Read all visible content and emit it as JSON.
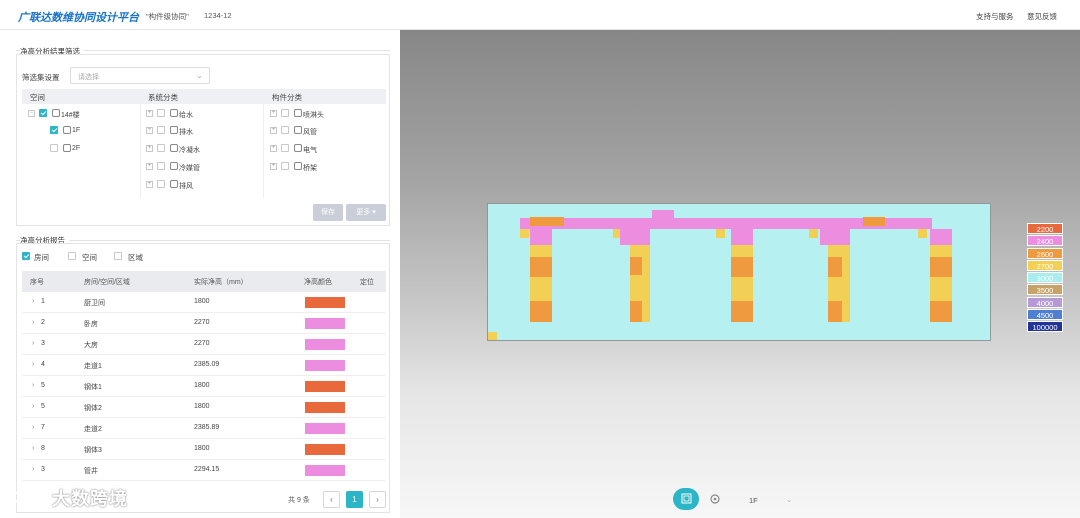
{
  "header": {
    "brand": "广联达数维协同设计平台",
    "project": "\"构件级协同\"",
    "project_code": "1234-12",
    "links": [
      "支持与服务",
      "意见反馈"
    ]
  },
  "filter": {
    "title": "净高分析结果筛选",
    "set_label": "筛选集设置",
    "set_placeholder": "请选择",
    "columns": [
      "空间",
      "系统分类",
      "构件分类"
    ],
    "space_tree": [
      {
        "label": "14#楼",
        "checked": true
      },
      {
        "label": "1F",
        "checked": true
      },
      {
        "label": "2F",
        "checked": false
      }
    ],
    "system_items": [
      "给水",
      "排水",
      "冷凝水",
      "冷媒管",
      "排风"
    ],
    "component_items": [
      "喷淋头",
      "风管",
      "电气",
      "桥架"
    ],
    "save_label": "保存",
    "more_label": "更多 ▾"
  },
  "report": {
    "title": "净高分析报告",
    "filters": [
      {
        "label": "房间",
        "checked": true
      },
      {
        "label": "空间",
        "checked": false
      },
      {
        "label": "区域",
        "checked": false
      }
    ],
    "columns": [
      "序号",
      "房间/空间/区域",
      "实际净高（mm）",
      "净高颜色",
      "定位"
    ],
    "rows": [
      {
        "no": "1",
        "name": "厨卫间",
        "height": "1800",
        "color": "#e8693b"
      },
      {
        "no": "2",
        "name": "卧房",
        "height": "2270",
        "color": "#ec8de0"
      },
      {
        "no": "3",
        "name": "大房",
        "height": "2270",
        "color": "#ec8de0"
      },
      {
        "no": "4",
        "name": "走道1",
        "height": "2385.09",
        "color": "#ec8de0"
      },
      {
        "no": "5",
        "name": "钢体1",
        "height": "1800",
        "color": "#e8693b"
      },
      {
        "no": "5",
        "name": "钢体2",
        "height": "1800",
        "color": "#e8693b"
      },
      {
        "no": "7",
        "name": "走道2",
        "height": "2385.89",
        "color": "#ec8de0"
      },
      {
        "no": "8",
        "name": "钢体3",
        "height": "1800",
        "color": "#e8693b"
      },
      {
        "no": "3",
        "name": "管井",
        "height": "2294.15",
        "color": "#ec8de0"
      }
    ],
    "total": "共 9 条",
    "current_page": "1",
    "prev": "‹",
    "next": "›"
  },
  "legend": [
    {
      "label": "2200",
      "color": "#e8693b"
    },
    {
      "label": "2400",
      "color": "#ec8de0"
    },
    {
      "label": "2600",
      "color": "#ef9a3f"
    },
    {
      "label": "2700",
      "color": "#f2cf55"
    },
    {
      "label": "3000",
      "color": "#a8eeee"
    },
    {
      "label": "3500",
      "color": "#c7a36a"
    },
    {
      "label": "4000",
      "color": "#b59ad6"
    },
    {
      "label": "4500",
      "color": "#4f7fd1"
    },
    {
      "label": "100000",
      "color": "#22349a"
    }
  ],
  "view_toolbar": {
    "floor": "1F",
    "icons": [
      "plan-view-icon",
      "settings-icon",
      "chevron-down-icon"
    ]
  },
  "watermark": "大数跨境",
  "colors": {
    "accent": "#2cb5c6",
    "brand": "#1a73c8"
  }
}
